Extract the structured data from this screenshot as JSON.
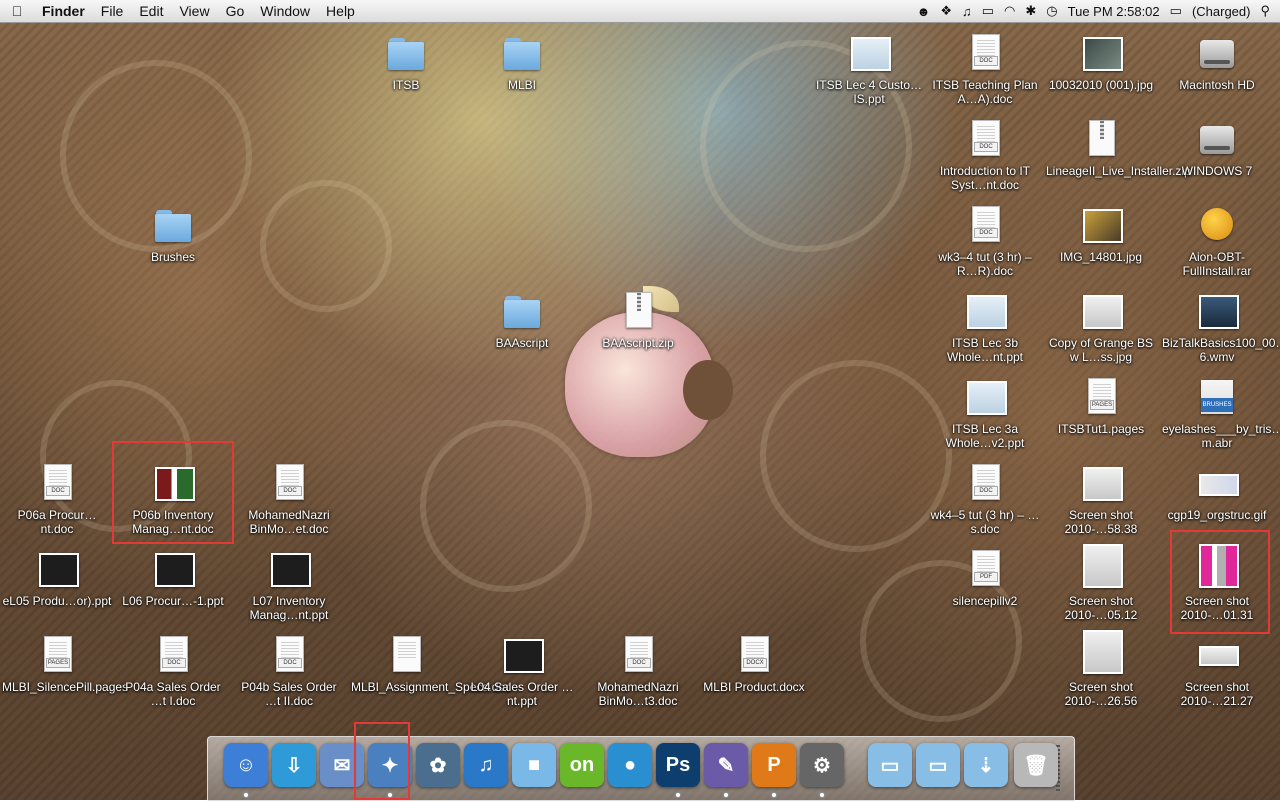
{
  "menubar": {
    "apple": "",
    "app": "Finder",
    "menus": [
      "File",
      "Edit",
      "View",
      "Go",
      "Window",
      "Help"
    ],
    "clock": "Tue PM 2:58:02",
    "battery": "(Charged)"
  },
  "desktop": {
    "icons": [
      {
        "label": "ITSB"
      },
      {
        "label": "MLBI"
      },
      {
        "label": "ITSB Lec 4 Custo…IS.ppt"
      },
      {
        "label": "ITSB Teaching Plan A…A).doc",
        "tag": "DOC"
      },
      {
        "label": "10032010 (001).jpg"
      },
      {
        "label": "Macintosh HD"
      },
      {
        "label": "Introduction to IT Syst…nt.doc",
        "tag": "DOC"
      },
      {
        "label": "LineageII_Live_Installer.zip"
      },
      {
        "label": "WINDOWS 7"
      },
      {
        "label": "Brushes"
      },
      {
        "label": "wk3–4 tut (3 hr) – R…R).doc",
        "tag": "DOC"
      },
      {
        "label": "IMG_14801.jpg"
      },
      {
        "label": "Aion-OBT-FullInstall.rar"
      },
      {
        "label": "BAAscript"
      },
      {
        "label": "BAAscript.zip",
        "tag": "ZIP"
      },
      {
        "label": "ITSB Lec 3b Whole…nt.ppt"
      },
      {
        "label": "Copy of Grange BS w L…ss.jpg"
      },
      {
        "label": "BizTalkBasics100_00…6.wmv"
      },
      {
        "label": "ITSB Lec 3a Whole…v2.ppt"
      },
      {
        "label": "ITSBTut1.pages",
        "tag": "PAGES"
      },
      {
        "label": "eyelashes___by_tris…m.abr"
      },
      {
        "label": "P06a Procur…nt.doc",
        "tag": "DOC"
      },
      {
        "label": "P06b Inventory Manag…nt.doc"
      },
      {
        "label": "MohamedNazri BinMo…et.doc",
        "tag": "DOC"
      },
      {
        "label": "wk4–5 tut (3 hr) – …s.doc",
        "tag": "DOC"
      },
      {
        "label": "Screen shot 2010-…58.38"
      },
      {
        "label": "cgp19_orgstruc.gif"
      },
      {
        "label": "eL05 Produ…or).ppt"
      },
      {
        "label": "L06 Procur…-1.ppt"
      },
      {
        "label": "L07 Inventory Manag…nt.ppt"
      },
      {
        "label": "silencepillv2",
        "tag": "PDF"
      },
      {
        "label": "Screen shot 2010-…05.12"
      },
      {
        "label": "Screen shot 2010-…01.31"
      },
      {
        "label": "MLBI_SilencePill.pages",
        "tag": "PAGES"
      },
      {
        "label": "P04a Sales Order …t I.doc",
        "tag": "DOC"
      },
      {
        "label": "P04b Sales Order …t II.doc",
        "tag": "DOC"
      },
      {
        "label": "MLBI_Assignment_Specs.doc"
      },
      {
        "label": "L04 Sales Order …nt.ppt"
      },
      {
        "label": "MohamedNazri BinMo…t3.doc",
        "tag": "DOC"
      },
      {
        "label": "MLBI Product.docx",
        "tag": "DOCX"
      },
      {
        "label": "Screen shot 2010-…26.56"
      },
      {
        "label": "Screen shot 2010-…21.27"
      }
    ]
  },
  "dock": {
    "items": [
      {
        "name": "Finder",
        "glyph": "☺",
        "color": "#3d7fd6",
        "running": true
      },
      {
        "name": "Network",
        "glyph": "⇩",
        "color": "#2f9ad8",
        "running": false
      },
      {
        "name": "Mail",
        "glyph": "✉",
        "color": "#6a8fc8",
        "running": false
      },
      {
        "name": "Safari",
        "glyph": "✦",
        "color": "#4a7fc0",
        "running": true
      },
      {
        "name": "iPhoto",
        "glyph": "✿",
        "color": "#4b6e8f",
        "running": false
      },
      {
        "name": "iTunes",
        "glyph": "♫",
        "color": "#2a78c8",
        "running": false
      },
      {
        "name": "3D Box",
        "glyph": "■",
        "color": "#7ab8e8",
        "running": false
      },
      {
        "name": "ON",
        "glyph": "on",
        "color": "#6ab82a",
        "running": false
      },
      {
        "name": "Messenger",
        "glyph": "●",
        "color": "#2a8fd0",
        "running": false
      },
      {
        "name": "Photoshop",
        "glyph": "Ps",
        "color": "#0e3e6e",
        "running": true
      },
      {
        "name": "Script Editor",
        "glyph": "✎",
        "color": "#6b5aa8",
        "running": true
      },
      {
        "name": "PowerPoint",
        "glyph": "P",
        "color": "#e07a18",
        "running": true
      },
      {
        "name": "Instruments",
        "glyph": "⚙",
        "color": "#666666",
        "running": true
      },
      {
        "name": "Applications",
        "glyph": "▭",
        "color": "#88bde6",
        "running": false
      },
      {
        "name": "Documents",
        "glyph": "▭",
        "color": "#88bde6",
        "running": false
      },
      {
        "name": "Downloads",
        "glyph": "⇣",
        "color": "#88bde6",
        "running": false
      },
      {
        "name": "Trash",
        "glyph": "🗑",
        "color": "#b8b8b8",
        "running": false
      }
    ]
  }
}
